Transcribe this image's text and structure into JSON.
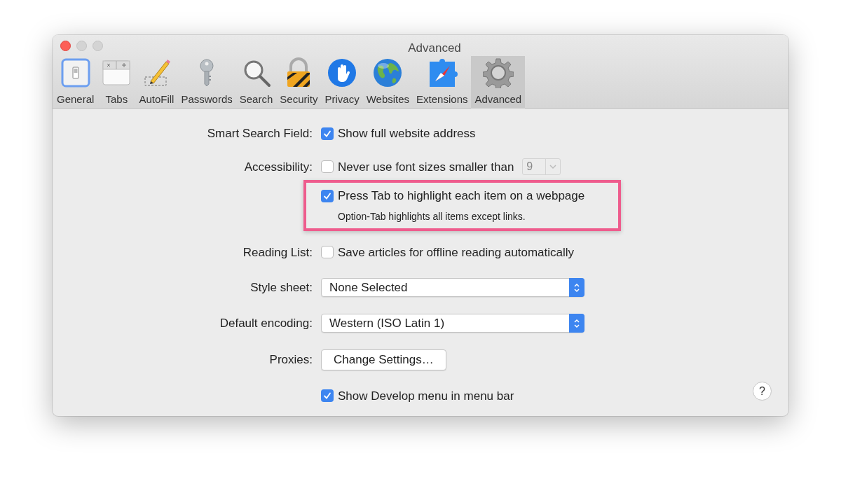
{
  "window": {
    "title": "Advanced"
  },
  "toolbar": [
    {
      "label": "General",
      "selected": false
    },
    {
      "label": "Tabs",
      "selected": false
    },
    {
      "label": "AutoFill",
      "selected": false
    },
    {
      "label": "Passwords",
      "selected": false
    },
    {
      "label": "Search",
      "selected": false
    },
    {
      "label": "Security",
      "selected": false
    },
    {
      "label": "Privacy",
      "selected": false
    },
    {
      "label": "Websites",
      "selected": false
    },
    {
      "label": "Extensions",
      "selected": false
    },
    {
      "label": "Advanced",
      "selected": true
    }
  ],
  "settings": [
    {
      "kind": "checkbox",
      "label": "Smart Search Field:",
      "text": "Show full website address",
      "checked": true
    },
    {
      "kind": "checkbox_size",
      "label": "Accessibility:",
      "text": "Never use font sizes smaller than",
      "checked": false,
      "value": "9",
      "disabled": true
    },
    {
      "kind": "checkbox_note",
      "text": "Press Tab to highlight each item on a webpage",
      "checked": true,
      "note": "Option-Tab highlights all items except links.",
      "highlighted": true
    },
    {
      "kind": "checkbox",
      "label": "Reading List:",
      "text": "Save articles for offline reading automatically",
      "checked": false
    },
    {
      "kind": "select",
      "label": "Style sheet:",
      "value": "None Selected"
    },
    {
      "kind": "select",
      "label": "Default encoding:",
      "value": "Western (ISO Latin 1)"
    },
    {
      "kind": "button",
      "label": "Proxies:",
      "text": "Change Settings…"
    },
    {
      "kind": "checkbox",
      "text": "Show Develop menu in menu bar",
      "checked": true
    }
  ],
  "help_button": "?"
}
